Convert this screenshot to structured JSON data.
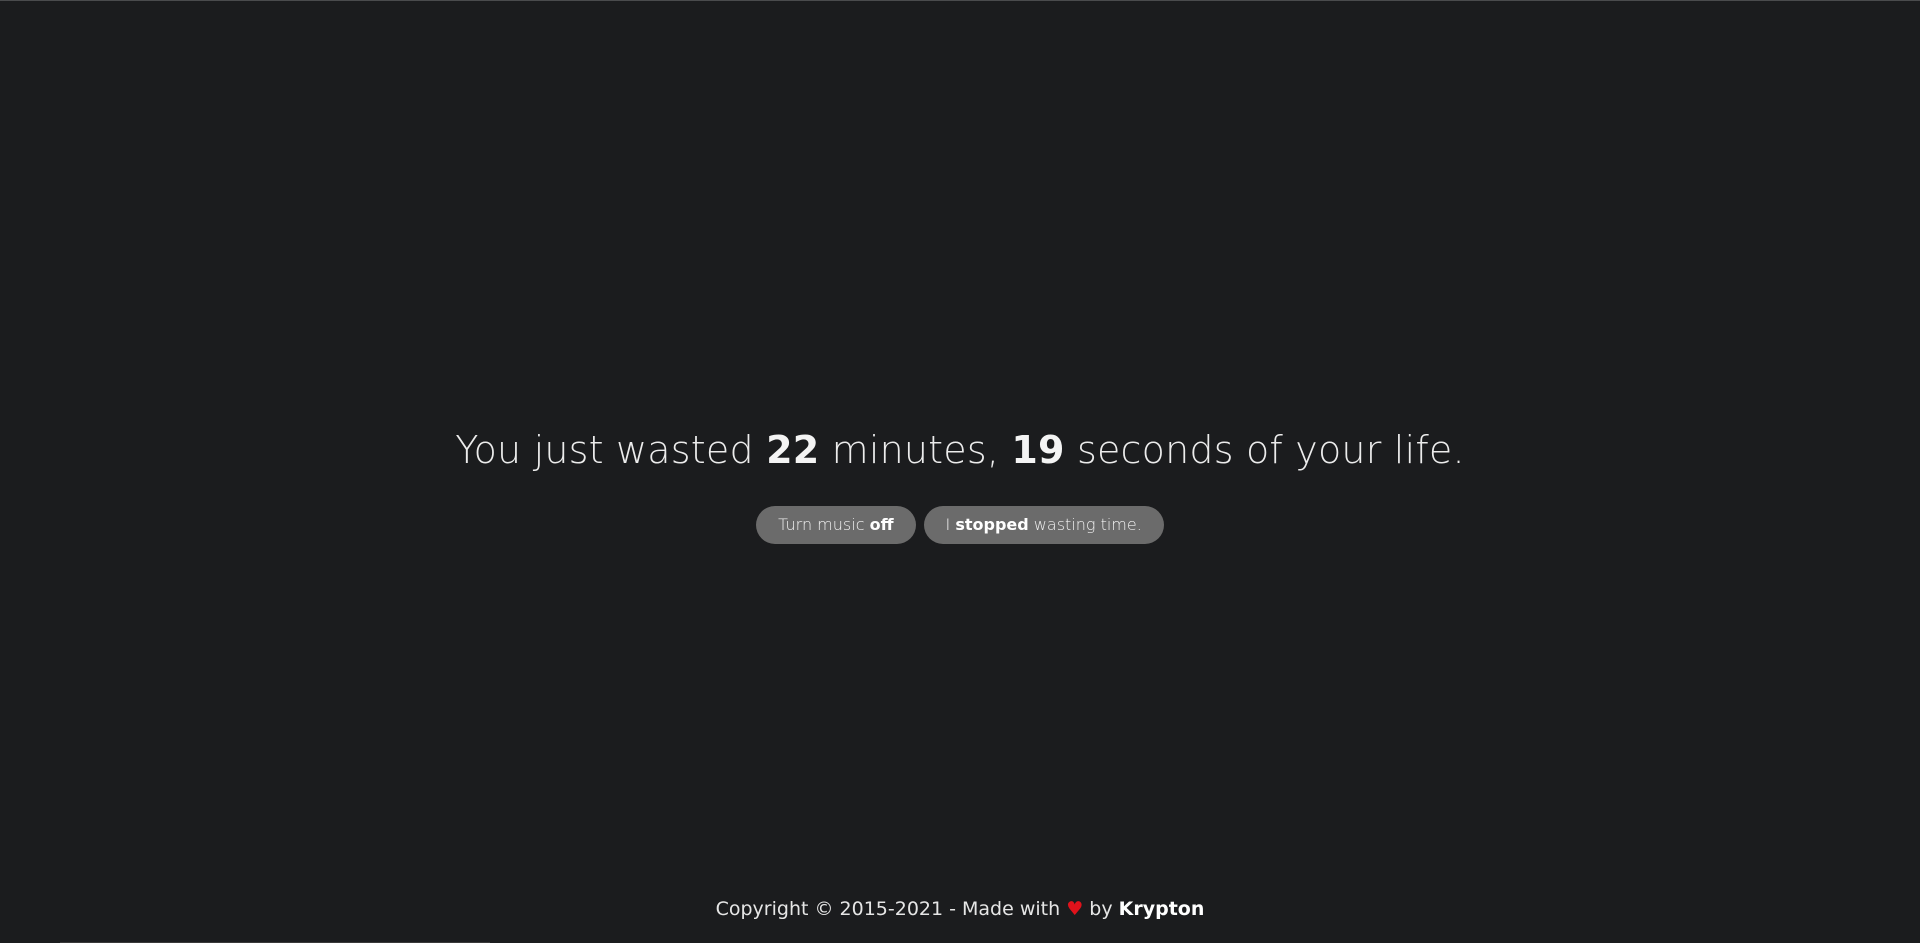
{
  "headline": {
    "prefix": "You just wasted ",
    "minutes_value": "22",
    "minutes_label": " minutes, ",
    "seconds_value": "19",
    "suffix": " seconds of your life."
  },
  "buttons": {
    "music": {
      "text": "Turn music ",
      "bold": "off"
    },
    "stop": {
      "prefix": "I ",
      "bold": "stopped",
      "suffix": " wasting time."
    }
  },
  "footer": {
    "prefix": "Copyright © 2015-2021 - Made with ",
    "heart_icon": "heart-icon",
    "middle": " by ",
    "brand": "Krypton"
  },
  "colors": {
    "background": "#1b1c1e",
    "button": "#6b6b6b",
    "heart": "#e0121b"
  }
}
